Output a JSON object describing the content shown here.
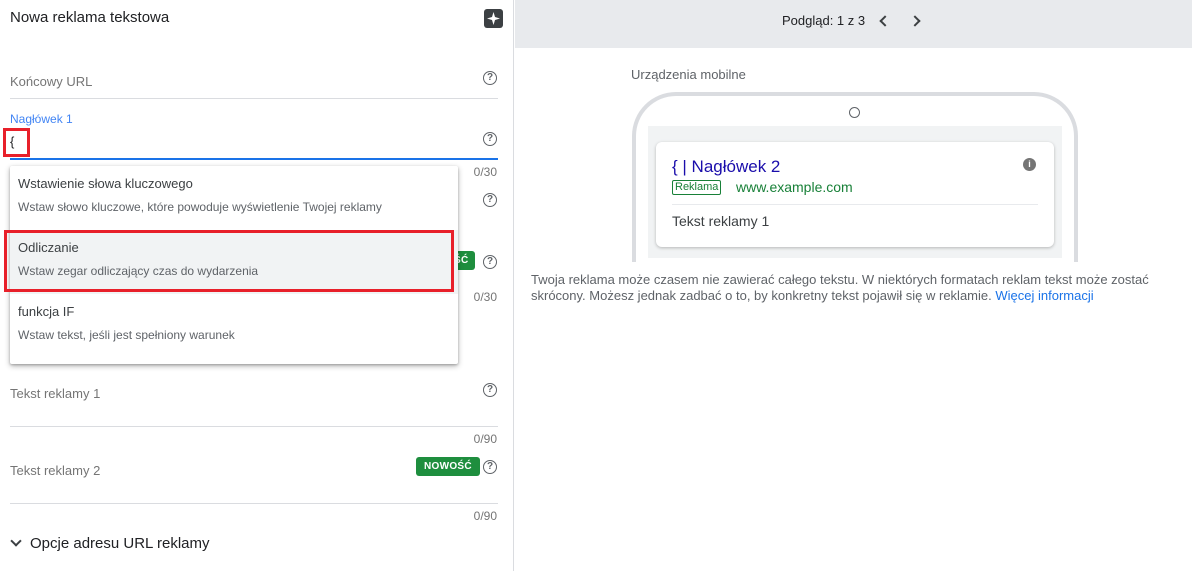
{
  "editor": {
    "title": "Nowa reklama tekstowa",
    "final_url_label": "Końcowy URL",
    "headline1_label": "Nagłówek 1",
    "headline1_value": "{",
    "headline1_counter": "0/30",
    "headline3_counter": "0/30",
    "badge_partial": "ŚĆ",
    "body1_label": "Tekst reklamy 1",
    "body1_counter": "0/90",
    "body2_label": "Tekst reklamy 2",
    "body2_counter": "0/90",
    "new_badge": "NOWOŚĆ",
    "url_options_label": "Opcje adresu URL reklamy"
  },
  "dropdown": {
    "items": [
      {
        "title": "Wstawienie słowa kluczowego",
        "desc": "Wstaw słowo kluczowe, które powoduje wyświetlenie Twojej reklamy"
      },
      {
        "title": "Odliczanie",
        "desc": "Wstaw zegar odliczający czas do wydarzenia"
      },
      {
        "title": "funkcja IF",
        "desc": "Wstaw tekst, jeśli jest spełniony warunek"
      }
    ]
  },
  "preview": {
    "label": "Podgląd: 1 z 3",
    "device_label": "Urządzenia mobilne",
    "ad_headline": "{ | Nagłówek 2",
    "ad_badge": "Reklama",
    "ad_url": "www.example.com",
    "ad_body": "Tekst reklamy 1",
    "note": "Twoja reklama może czasem nie zawierać całego tekstu. W niektórych formatach reklam tekst może zostać skrócony. Możesz jednak zadbać o to, by konkretny tekst pojawił się w reklamie.",
    "learn_more": "Więcej informacji"
  },
  "colors": {
    "accent": "#1a73e8",
    "highlight": "#e8202a",
    "badge": "#1e8e3e"
  },
  "icons": [
    "sparkle-icon",
    "help-icon",
    "chevron-down-icon",
    "chevron-left-icon",
    "chevron-right-icon",
    "info-icon"
  ]
}
